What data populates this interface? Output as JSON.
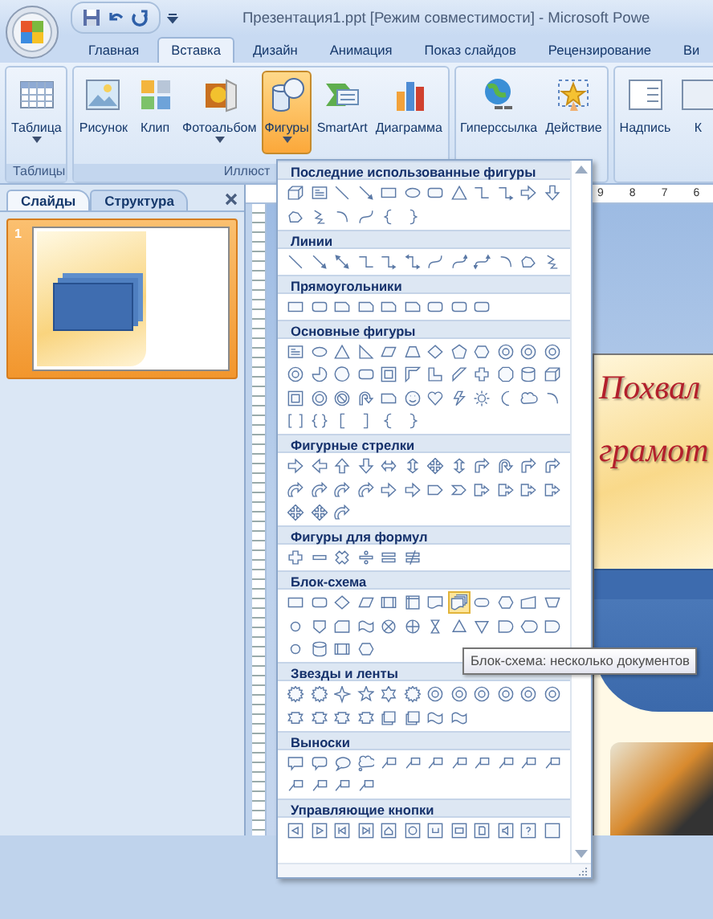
{
  "window": {
    "title": "Презентация1.ppt [Режим совместимости] - Microsoft Powe"
  },
  "tabs": [
    {
      "label": "Главная",
      "selected": false
    },
    {
      "label": "Вставка",
      "selected": true
    },
    {
      "label": "Дизайн",
      "selected": false
    },
    {
      "label": "Анимация",
      "selected": false
    },
    {
      "label": "Показ слайдов",
      "selected": false
    },
    {
      "label": "Рецензирование",
      "selected": false
    },
    {
      "label": "Ви",
      "selected": false
    }
  ],
  "ribbon": {
    "groups": [
      {
        "label": "Таблицы",
        "buttons": [
          {
            "label": "Таблица",
            "kind": "table",
            "dropdown": true,
            "active": false
          }
        ]
      },
      {
        "label": "Иллюст",
        "buttons": [
          {
            "label": "Рисунок",
            "kind": "picture",
            "dropdown": false,
            "active": false
          },
          {
            "label": "Клип",
            "kind": "clip",
            "dropdown": false,
            "active": false
          },
          {
            "label": "Фотоальбом",
            "kind": "album",
            "dropdown": true,
            "active": false
          },
          {
            "label": "Фигуры",
            "kind": "shapes",
            "dropdown": true,
            "active": true
          },
          {
            "label": "SmartArt",
            "kind": "smartart",
            "dropdown": false,
            "active": false
          },
          {
            "label": "Диаграмма",
            "kind": "chart",
            "dropdown": false,
            "active": false
          }
        ]
      },
      {
        "buttons": [
          {
            "label": "Гиперссылка",
            "kind": "hyperlink",
            "dropdown": false,
            "active": false
          },
          {
            "label": "Действие",
            "kind": "action",
            "dropdown": false,
            "active": false
          }
        ]
      },
      {
        "buttons": [
          {
            "label": "Надпись",
            "kind": "textbox",
            "dropdown": false,
            "active": false
          },
          {
            "label": "К",
            "kind": "partial",
            "dropdown": false,
            "active": false
          }
        ]
      }
    ]
  },
  "slides_pane": {
    "tabs": [
      {
        "label": "Слайды",
        "selected": true
      },
      {
        "label": "Структура",
        "selected": false
      }
    ],
    "slides": [
      {
        "number": "1",
        "selected": true
      }
    ]
  },
  "ruler": {
    "numbers": [
      "9",
      "8",
      "7",
      "6"
    ]
  },
  "slide": {
    "title_lines": [
      "Похвал",
      "грамот"
    ]
  },
  "gallery": {
    "sections": [
      {
        "title": "Последние использованные фигуры",
        "shapes": [
          {
            "kind": "cube",
            "hovered": false
          },
          {
            "kind": "textbox",
            "hovered": false
          },
          {
            "kind": "line",
            "hovered": false
          },
          {
            "kind": "arrow",
            "hovered": false
          },
          {
            "kind": "rect",
            "hovered": false
          },
          {
            "kind": "oval",
            "hovered": false
          },
          {
            "kind": "round-rect",
            "hovered": false
          },
          {
            "kind": "triangle",
            "hovered": false
          },
          {
            "kind": "elbow",
            "hovered": false
          },
          {
            "kind": "elbow-arrow",
            "hovered": false
          },
          {
            "kind": "arrow-r",
            "hovered": false
          },
          {
            "kind": "arrow-d",
            "hovered": false
          },
          {
            "kind": "freeform",
            "hovered": false
          },
          {
            "kind": "scribble",
            "hovered": false
          },
          {
            "kind": "arc",
            "hovered": false
          },
          {
            "kind": "curve",
            "hovered": false
          },
          {
            "kind": "brace-l",
            "hovered": false
          },
          {
            "kind": "brace-r",
            "hovered": false
          }
        ]
      },
      {
        "title": "Линии",
        "shapes": [
          {
            "kind": "line",
            "hovered": false
          },
          {
            "kind": "arrow",
            "hovered": false
          },
          {
            "kind": "double-arrow",
            "hovered": false
          },
          {
            "kind": "elbow",
            "hovered": false
          },
          {
            "kind": "elbow-arrow",
            "hovered": false
          },
          {
            "kind": "elbow-double",
            "hovered": false
          },
          {
            "kind": "curve",
            "hovered": false
          },
          {
            "kind": "curve-arrow",
            "hovered": false
          },
          {
            "kind": "curve-double",
            "hovered": false
          },
          {
            "kind": "arc",
            "hovered": false
          },
          {
            "kind": "freeform",
            "hovered": false
          },
          {
            "kind": "scribble",
            "hovered": false
          }
        ]
      },
      {
        "title": "Прямоугольники",
        "shapes": [
          {
            "kind": "rect",
            "hovered": false
          },
          {
            "kind": "round-rect",
            "hovered": false
          },
          {
            "kind": "snip-rect",
            "hovered": false
          },
          {
            "kind": "snip-rect",
            "hovered": false
          },
          {
            "kind": "snip-rect",
            "hovered": false
          },
          {
            "kind": "snip-rect",
            "hovered": false
          },
          {
            "kind": "round-rect",
            "hovered": false
          },
          {
            "kind": "round-rect",
            "hovered": false
          },
          {
            "kind": "round-rect",
            "hovered": false
          }
        ]
      },
      {
        "title": "Основные фигуры",
        "shapes": [
          {
            "kind": "textbox",
            "hovered": false
          },
          {
            "kind": "oval",
            "hovered": false
          },
          {
            "kind": "triangle",
            "hovered": false
          },
          {
            "kind": "rtriangle",
            "hovered": false
          },
          {
            "kind": "parallelogram",
            "hovered": false
          },
          {
            "kind": "trapezoid",
            "hovered": false
          },
          {
            "kind": "diamond",
            "hovered": false
          },
          {
            "kind": "pentagon",
            "hovered": false
          },
          {
            "kind": "hexagon",
            "hovered": false
          },
          {
            "kind": "seal-n",
            "hovered": false
          },
          {
            "kind": "seal-n",
            "hovered": false
          },
          {
            "kind": "seal-n",
            "hovered": false
          },
          {
            "kind": "seal-n",
            "hovered": false
          },
          {
            "kind": "pie",
            "hovered": false
          },
          {
            "kind": "chord",
            "hovered": false
          },
          {
            "kind": "round-rect",
            "hovered": false
          },
          {
            "kind": "frame",
            "hovered": false
          },
          {
            "kind": "half-frame",
            "hovered": false
          },
          {
            "kind": "l-shape",
            "hovered": false
          },
          {
            "kind": "diagonal",
            "hovered": false
          },
          {
            "kind": "plus",
            "hovered": false
          },
          {
            "kind": "octagon",
            "hovered": false
          },
          {
            "kind": "can",
            "hovered": false
          },
          {
            "kind": "cube",
            "hovered": false
          },
          {
            "kind": "frame",
            "hovered": false
          },
          {
            "kind": "donut",
            "hovered": false
          },
          {
            "kind": "no-symbol",
            "hovered": false
          },
          {
            "kind": "uturn",
            "hovered": false
          },
          {
            "kind": "snip-rect",
            "hovered": false
          },
          {
            "kind": "smiley",
            "hovered": false
          },
          {
            "kind": "heart",
            "hovered": false
          },
          {
            "kind": "lightning",
            "hovered": false
          },
          {
            "kind": "sun",
            "hovered": false
          },
          {
            "kind": "moon",
            "hovered": false
          },
          {
            "kind": "cloud",
            "hovered": false
          },
          {
            "kind": "arc",
            "hovered": false
          },
          {
            "kind": "bracket-pair",
            "hovered": false
          },
          {
            "kind": "brace-pair",
            "hovered": false
          },
          {
            "kind": "bracket-l",
            "hovered": false
          },
          {
            "kind": "bracket-r",
            "hovered": false
          },
          {
            "kind": "brace-l",
            "hovered": false
          },
          {
            "kind": "brace-r",
            "hovered": false
          }
        ]
      },
      {
        "title": "Фигурные стрелки",
        "shapes": [
          {
            "kind": "arrow-r",
            "hovered": false
          },
          {
            "kind": "arrow-l",
            "hovered": false
          },
          {
            "kind": "arrow-u",
            "hovered": false
          },
          {
            "kind": "arrow-d",
            "hovered": false
          },
          {
            "kind": "arrow-lr",
            "hovered": false
          },
          {
            "kind": "arrow-ud",
            "hovered": false
          },
          {
            "kind": "arrow-quad",
            "hovered": false
          },
          {
            "kind": "arrow-ud",
            "hovered": false
          },
          {
            "kind": "bent-arrow",
            "hovered": false
          },
          {
            "kind": "uturn",
            "hovered": false
          },
          {
            "kind": "bent-arrow",
            "hovered": false
          },
          {
            "kind": "bent-arrow",
            "hovered": false
          },
          {
            "kind": "curved-arrow",
            "hovered": false
          },
          {
            "kind": "curved-arrow",
            "hovered": false
          },
          {
            "kind": "curved-arrow",
            "hovered": false
          },
          {
            "kind": "curved-arrow",
            "hovered": false
          },
          {
            "kind": "arrow-r",
            "hovered": false
          },
          {
            "kind": "arrow-r",
            "hovered": false
          },
          {
            "kind": "pentagon-arrow",
            "hovered": false
          },
          {
            "kind": "chevron",
            "hovered": false
          },
          {
            "kind": "callout-arrow",
            "hovered": false
          },
          {
            "kind": "callout-arrow",
            "hovered": false
          },
          {
            "kind": "callout-arrow",
            "hovered": false
          },
          {
            "kind": "callout-arrow",
            "hovered": false
          },
          {
            "kind": "arrow-quad",
            "hovered": false
          },
          {
            "kind": "arrow-quad",
            "hovered": false
          },
          {
            "kind": "curved-arrow",
            "hovered": false
          }
        ]
      },
      {
        "title": "Фигуры для формул",
        "shapes": [
          {
            "kind": "plus",
            "hovered": false
          },
          {
            "kind": "minus",
            "hovered": false
          },
          {
            "kind": "cross",
            "hovered": false
          },
          {
            "kind": "divide",
            "hovered": false
          },
          {
            "kind": "equal",
            "hovered": false
          },
          {
            "kind": "not-equal",
            "hovered": false
          }
        ]
      },
      {
        "title": "Блок-схема",
        "shapes": [
          {
            "kind": "rect",
            "hovered": false
          },
          {
            "kind": "round-rect",
            "hovered": false
          },
          {
            "kind": "diamond",
            "hovered": false
          },
          {
            "kind": "parallelogram",
            "hovered": false
          },
          {
            "kind": "predefined",
            "hovered": false
          },
          {
            "kind": "internal-storage",
            "hovered": false
          },
          {
            "kind": "doc",
            "hovered": false
          },
          {
            "kind": "multidoc",
            "hovered": true
          },
          {
            "kind": "terminator",
            "hovered": false
          },
          {
            "kind": "hexagon",
            "hovered": false
          },
          {
            "kind": "manual-input",
            "hovered": false
          },
          {
            "kind": "manual-op",
            "hovered": false
          },
          {
            "kind": "circle",
            "hovered": false
          },
          {
            "kind": "offpage",
            "hovered": false
          },
          {
            "kind": "punched-card",
            "hovered": false
          },
          {
            "kind": "wave",
            "hovered": false
          },
          {
            "kind": "summing",
            "hovered": false
          },
          {
            "kind": "or",
            "hovered": false
          },
          {
            "kind": "collate",
            "hovered": false
          },
          {
            "kind": "extract",
            "hovered": false
          },
          {
            "kind": "merge",
            "hovered": false
          },
          {
            "kind": "delay",
            "hovered": false
          },
          {
            "kind": "display",
            "hovered": false
          },
          {
            "kind": "delay",
            "hovered": false
          },
          {
            "kind": "circle",
            "hovered": false
          },
          {
            "kind": "can",
            "hovered": false
          },
          {
            "kind": "predefined",
            "hovered": false
          },
          {
            "kind": "hexagon",
            "hovered": false
          }
        ]
      },
      {
        "title": "Звезды и ленты",
        "shapes": [
          {
            "kind": "seal",
            "hovered": false
          },
          {
            "kind": "seal",
            "hovered": false
          },
          {
            "kind": "star4",
            "hovered": false
          },
          {
            "kind": "star5",
            "hovered": false
          },
          {
            "kind": "star6",
            "hovered": false
          },
          {
            "kind": "seal",
            "hovered": false
          },
          {
            "kind": "seal-n",
            "hovered": false
          },
          {
            "kind": "seal-n",
            "hovered": false
          },
          {
            "kind": "seal-n",
            "hovered": false
          },
          {
            "kind": "seal-n",
            "hovered": false
          },
          {
            "kind": "seal-n",
            "hovered": false
          },
          {
            "kind": "seal-n",
            "hovered": false
          },
          {
            "kind": "ribbon",
            "hovered": false
          },
          {
            "kind": "ribbon",
            "hovered": false
          },
          {
            "kind": "ribbon",
            "hovered": false
          },
          {
            "kind": "ribbon",
            "hovered": false
          },
          {
            "kind": "scroll",
            "hovered": false
          },
          {
            "kind": "scroll",
            "hovered": false
          },
          {
            "kind": "wave",
            "hovered": false
          },
          {
            "kind": "wave",
            "hovered": false
          }
        ]
      },
      {
        "title": "Выноски",
        "shapes": [
          {
            "kind": "callout-rect",
            "hovered": false
          },
          {
            "kind": "callout-round",
            "hovered": false
          },
          {
            "kind": "callout-oval",
            "hovered": false
          },
          {
            "kind": "callout-cloud",
            "hovered": false
          },
          {
            "kind": "callout-line",
            "hovered": false
          },
          {
            "kind": "callout-line",
            "hovered": false
          },
          {
            "kind": "callout-line",
            "hovered": false
          },
          {
            "kind": "callout-line",
            "hovered": false
          },
          {
            "kind": "callout-line",
            "hovered": false
          },
          {
            "kind": "callout-line",
            "hovered": false
          },
          {
            "kind": "callout-line",
            "hovered": false
          },
          {
            "kind": "callout-line",
            "hovered": false
          },
          {
            "kind": "callout-line",
            "hovered": false
          },
          {
            "kind": "callout-line",
            "hovered": false
          },
          {
            "kind": "callout-line",
            "hovered": false
          },
          {
            "kind": "callout-line",
            "hovered": false
          }
        ]
      },
      {
        "title": "Управляющие кнопки",
        "shapes": [
          {
            "kind": "action-back",
            "hovered": false
          },
          {
            "kind": "action-forward",
            "hovered": false
          },
          {
            "kind": "action-begin",
            "hovered": false
          },
          {
            "kind": "action-end",
            "hovered": false
          },
          {
            "kind": "action-home",
            "hovered": false
          },
          {
            "kind": "action-info",
            "hovered": false
          },
          {
            "kind": "action-return",
            "hovered": false
          },
          {
            "kind": "action-movie",
            "hovered": false
          },
          {
            "kind": "action-doc",
            "hovered": false
          },
          {
            "kind": "action-sound",
            "hovered": false
          },
          {
            "kind": "action-help",
            "hovered": false
          },
          {
            "kind": "action-blank",
            "hovered": false
          }
        ]
      }
    ],
    "tooltip": "Блок-схема: несколько документов"
  }
}
